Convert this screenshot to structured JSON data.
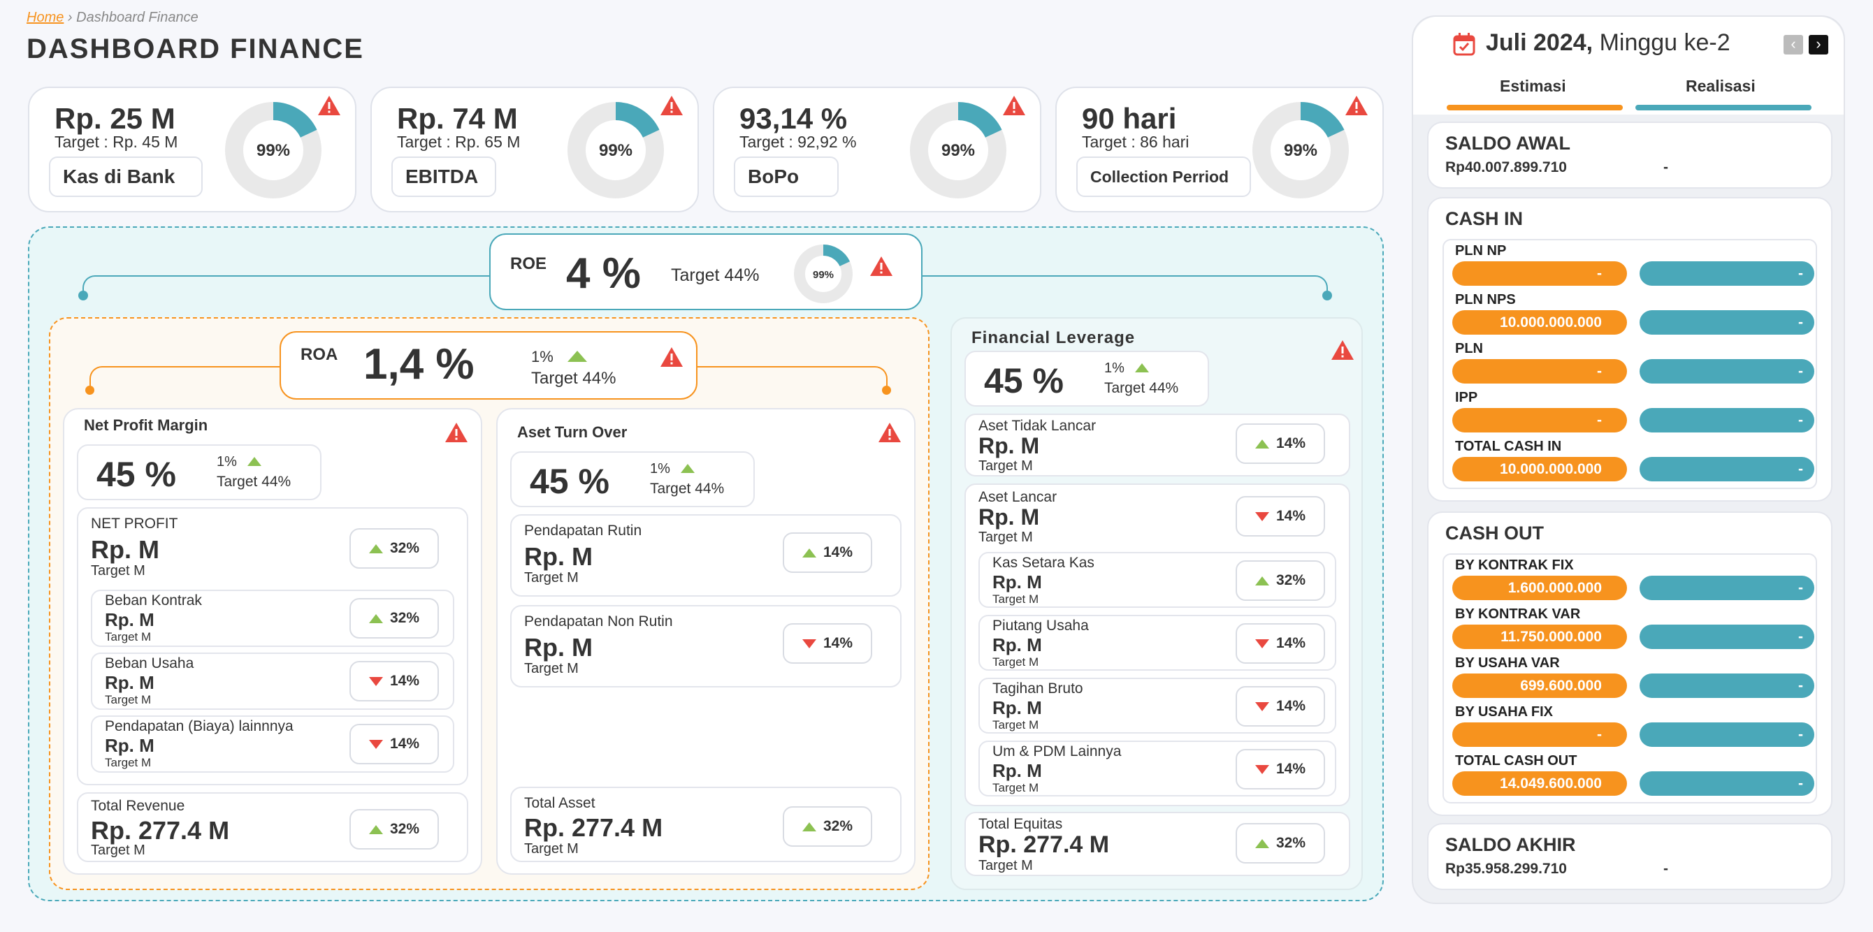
{
  "breadcrumb": {
    "home": "Home",
    "sep": "›",
    "current": "Dashboard Finance"
  },
  "page_title": "DASHBOARD FINANCE",
  "colors": {
    "accent_teal": "#4aa8b9",
    "accent_orange": "#f7931e",
    "warning_red": "#e9483f",
    "up_green": "#8cc152"
  },
  "kpis": [
    {
      "value": "Rp. 25 M",
      "target": "Target : Rp. 45 M",
      "label": "Kas di Bank",
      "pct": "99%",
      "fill": 0.18
    },
    {
      "value": "Rp. 74 M",
      "target": "Target : Rp. 65 M",
      "label": "EBITDA",
      "pct": "99%",
      "fill": 0.18
    },
    {
      "value": "93,14 %",
      "target": "Target : 92,92 %",
      "label": "BoPo",
      "pct": "99%",
      "fill": 0.18
    },
    {
      "value": "90 hari",
      "target": "Target : 86 hari",
      "label": "Collection Perriod",
      "pct": "99%",
      "fill": 0.18
    }
  ],
  "roe": {
    "label": "ROE",
    "value": "4 %",
    "target": "Target 44%",
    "pct": "99%"
  },
  "roa": {
    "label": "ROA",
    "value": "1,4 %",
    "change": "1%",
    "target": "Target 44%"
  },
  "npm": {
    "title": "Net Profit Margin",
    "value": "45 %",
    "change": "1%",
    "target": "Target 44%",
    "net_profit": {
      "label": "NET PROFIT",
      "value": "Rp. M",
      "target": "Target M",
      "pct": "32%"
    },
    "items": [
      {
        "label": "Beban Kontrak",
        "value": "Rp. M",
        "target": "Target M",
        "pct": "32%",
        "dir": "up"
      },
      {
        "label": "Beban Usaha",
        "value": "Rp. M",
        "target": "Target M",
        "pct": "14%",
        "dir": "down"
      },
      {
        "label": "Pendapatan (Biaya) lainnnya",
        "value": "Rp. M",
        "target": "Target M",
        "pct": "14%",
        "dir": "down"
      }
    ],
    "total": {
      "label": "Total Revenue",
      "value": "Rp. 277.4 M",
      "target": "Target M",
      "pct": "32%"
    }
  },
  "ato": {
    "title": "Aset Turn Over",
    "value": "45 %",
    "change": "1%",
    "target": "Target 44%",
    "items": [
      {
        "label": "Pendapatan Rutin",
        "value": "Rp. M",
        "target": "Target M",
        "pct": "14%",
        "dir": "up"
      },
      {
        "label": "Pendapatan Non Rutin",
        "value": "Rp. M",
        "target": "Target M",
        "pct": "14%",
        "dir": "down"
      }
    ],
    "total": {
      "label": "Total Asset",
      "value": "Rp. 277.4 M",
      "target": "Target M",
      "pct": "32%"
    }
  },
  "fl": {
    "title": "Financial Leverage",
    "value": "45 %",
    "change": "1%",
    "target": "Target 44%",
    "atl": {
      "label": "Aset Tidak Lancar",
      "value": "Rp. M",
      "target": "Target M",
      "pct": "14%"
    },
    "al": {
      "label": "Aset Lancar",
      "value": "Rp. M",
      "target": "Target M",
      "pct": "14%"
    },
    "items": [
      {
        "label": "Kas Setara Kas",
        "value": "Rp. M",
        "target": "Target M",
        "pct": "32%",
        "dir": "up"
      },
      {
        "label": "Piutang Usaha",
        "value": "Rp. M",
        "target": "Target M",
        "pct": "14%",
        "dir": "down"
      },
      {
        "label": "Tagihan Bruto",
        "value": "Rp. M",
        "target": "Target M",
        "pct": "14%",
        "dir": "down"
      },
      {
        "label": "Um & PDM Lainnya",
        "value": "Rp. M",
        "target": "Target M",
        "pct": "14%",
        "dir": "down"
      }
    ],
    "total": {
      "label": "Total Equitas",
      "value": "Rp. 277.4 M",
      "target": "Target M",
      "pct": "32%"
    }
  },
  "side": {
    "month": "Juli 2024,",
    "week": "Minggu ke-2",
    "tabs": [
      "Estimasi",
      "Realisasi"
    ],
    "saldo_awal": {
      "title": "SALDO AWAL",
      "estimasi": "Rp40.007.899.710",
      "realisasi": "-"
    },
    "cash_in": {
      "title": "CASH IN",
      "rows": [
        {
          "label": "PLN NP",
          "estimasi": "-",
          "realisasi": "-"
        },
        {
          "label": "PLN NPS",
          "estimasi": "10.000.000.000",
          "realisasi": "-"
        },
        {
          "label": "PLN",
          "estimasi": "-",
          "realisasi": "-"
        },
        {
          "label": "IPP",
          "estimasi": "-",
          "realisasi": "-"
        },
        {
          "label": "TOTAL CASH IN",
          "estimasi": "10.000.000.000",
          "realisasi": "-"
        }
      ]
    },
    "cash_out": {
      "title": "CASH OUT",
      "rows": [
        {
          "label": "BY KONTRAK FIX",
          "estimasi": "1.600.000.000",
          "realisasi": "-"
        },
        {
          "label": "BY KONTRAK VAR",
          "estimasi": "11.750.000.000",
          "realisasi": "-"
        },
        {
          "label": "BY USAHA VAR",
          "estimasi": "699.600.000",
          "realisasi": "-"
        },
        {
          "label": "BY USAHA FIX",
          "estimasi": "-",
          "realisasi": "-"
        },
        {
          "label": "TOTAL CASH OUT",
          "estimasi": "14.049.600.000",
          "realisasi": "-"
        }
      ]
    },
    "saldo_akhir": {
      "title": "SALDO AKHIR",
      "estimasi": "Rp35.958.299.710",
      "realisasi": "-"
    }
  }
}
